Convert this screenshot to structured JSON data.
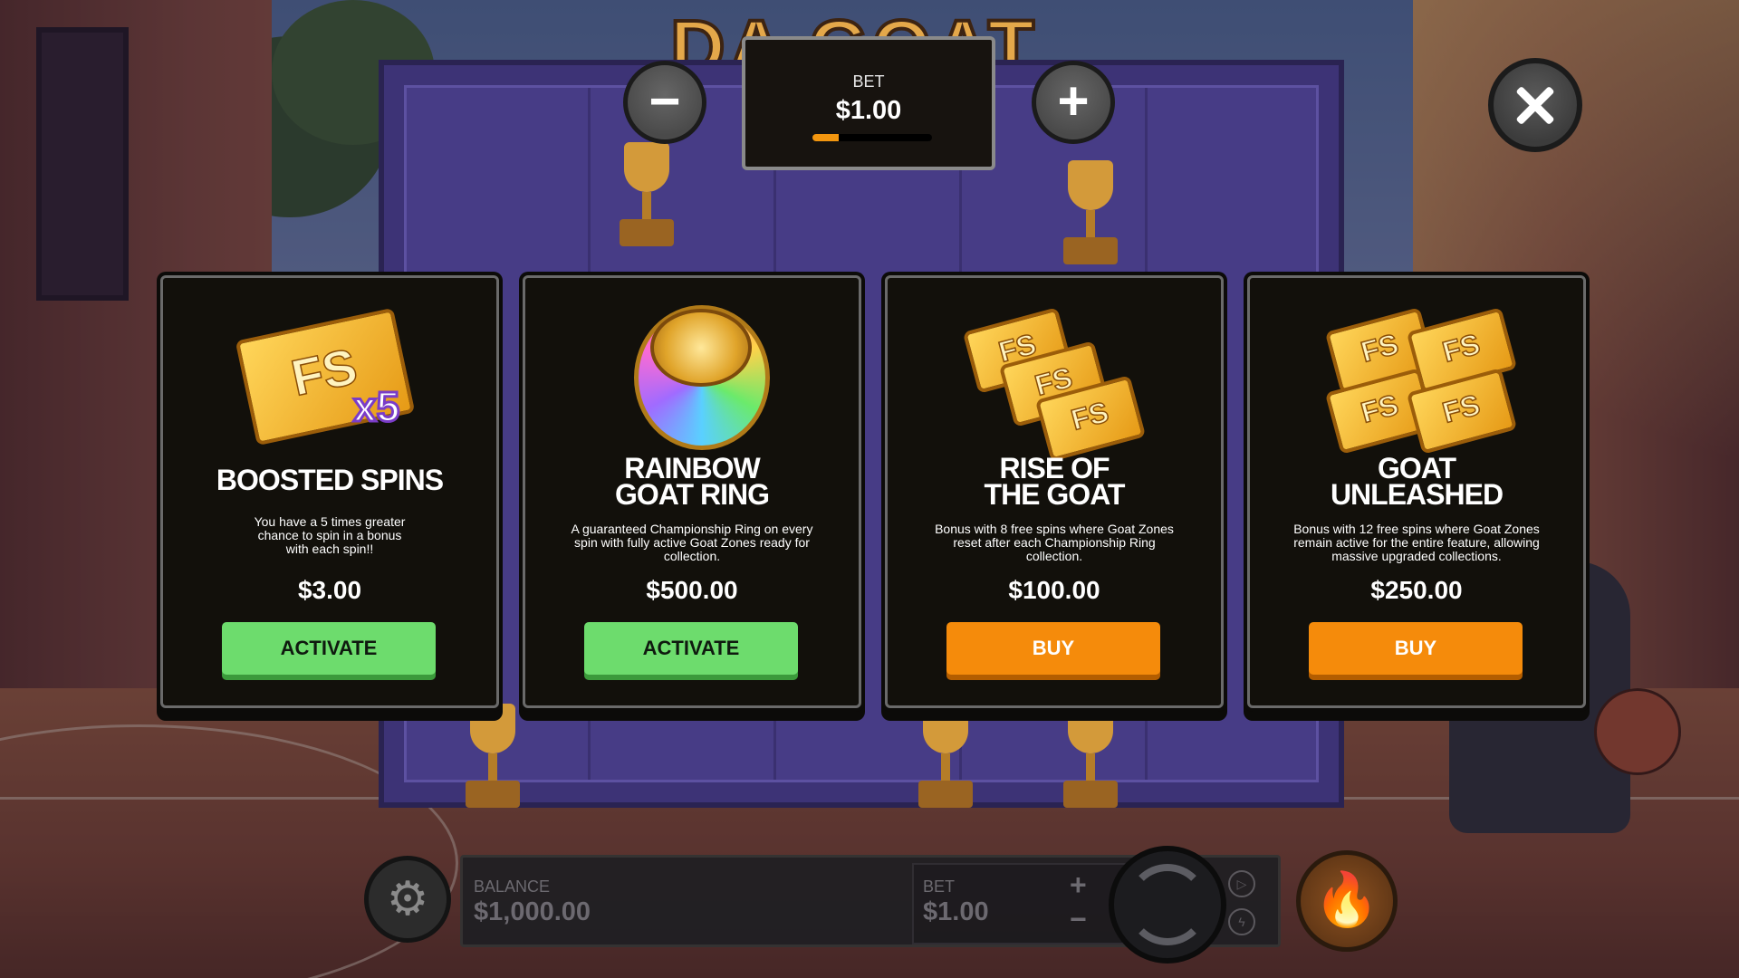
{
  "game": {
    "logo_text": "DA GOAT"
  },
  "bet_panel": {
    "label": "BET",
    "value": "$1.00",
    "level": 0.22,
    "minus_label": "−",
    "plus_label": "+"
  },
  "close_icon": "close-icon",
  "features": [
    {
      "title_line1": "BOOSTED SPINS",
      "title_line2": "",
      "description": "You have a 5 times greater chance to spin in a bonus with each spin!!",
      "price": "$3.00",
      "action": "ACTIVATE",
      "action_type": "activate",
      "art": {
        "ticket_text": "FS",
        "multiplier": "x5"
      }
    },
    {
      "title_line1": "RAINBOW",
      "title_line2": "GOAT RING",
      "description": "A guaranteed Championship Ring on every spin with fully active Goat Zones ready for collection.",
      "price": "$500.00",
      "action": "ACTIVATE",
      "action_type": "activate"
    },
    {
      "title_line1": "RISE OF",
      "title_line2": "THE GOAT",
      "description": "Bonus with 8 free spins where Goat Zones reset after each Championship Ring collection.",
      "price": "$100.00",
      "action": "BUY",
      "action_type": "buy",
      "art": {
        "ticket_text": "FS"
      }
    },
    {
      "title_line1": "GOAT",
      "title_line2": "UNLEASHED",
      "description": "Bonus with 12 free spins where Goat Zones remain active for the entire feature, allowing massive upgraded collections.",
      "price": "$250.00",
      "action": "BUY",
      "action_type": "buy",
      "art": {
        "ticket_text": "FS"
      }
    }
  ],
  "bottom_bar": {
    "balance_label": "BALANCE",
    "balance_value": "$1,000.00",
    "bet_label": "BET",
    "bet_value": "$1.00",
    "plus": "+",
    "minus": "−",
    "autoplay_icon": "▷",
    "turbo_icon": "ϟ",
    "settings_icon": "⚙",
    "fire_icon": "🔥"
  },
  "colors": {
    "activate": "#6ddc6d",
    "buy": "#f58b0b",
    "card_bg": "#12100b",
    "bet_level": "#f3960f"
  }
}
